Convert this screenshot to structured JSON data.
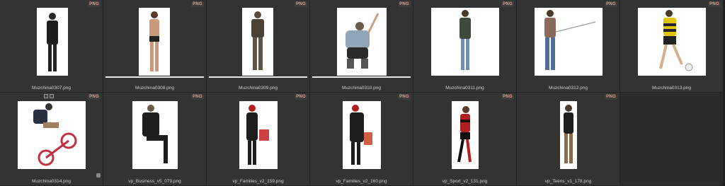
{
  "badge": "PNG",
  "items": [
    {
      "name": "Muzchina0307.png",
      "progress": false
    },
    {
      "name": "Muzchina0308.png",
      "progress": true
    },
    {
      "name": "Muzchina0309.png",
      "progress": true
    },
    {
      "name": "Muzchina0310.png",
      "progress": true
    },
    {
      "name": "Muzchina0311.png",
      "progress": false
    },
    {
      "name": "Muzchina0312.png",
      "progress": false
    },
    {
      "name": "Muzchina0313.png",
      "progress": false
    },
    {
      "name": "Muzchina0314.png",
      "progress": false
    },
    {
      "name": "vp_Business_v5_079.png",
      "progress": false
    },
    {
      "name": "vp_Families_v2_159.png",
      "progress": false
    },
    {
      "name": "vp_Families_v2_160.png",
      "progress": false
    },
    {
      "name": "vp_Sport_v2_131.png",
      "progress": false
    },
    {
      "name": "vp_Teens_v1_178.png",
      "progress": false
    }
  ]
}
